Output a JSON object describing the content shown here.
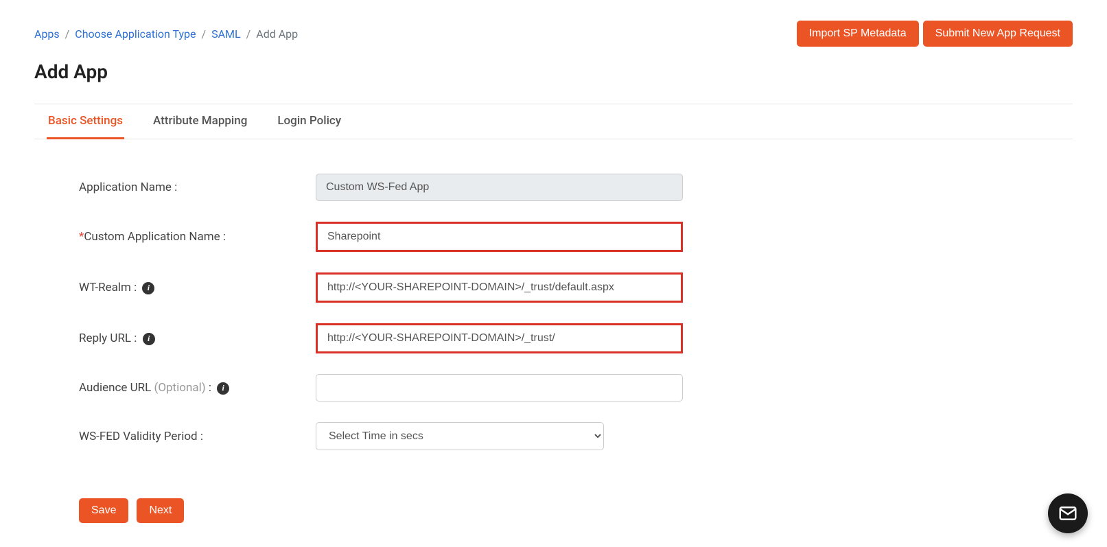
{
  "breadcrumb": {
    "apps": "Apps",
    "choose_type": "Choose Application Type",
    "saml": "SAML",
    "add_app": "Add App"
  },
  "topButtons": {
    "import": "Import SP Metadata",
    "submit": "Submit New App Request"
  },
  "pageTitle": "Add App",
  "tabs": {
    "basic": "Basic Settings",
    "attribute": "Attribute Mapping",
    "login": "Login Policy"
  },
  "form": {
    "appNameLabel": "Application Name :",
    "appNameValue": "Custom WS-Fed App",
    "customAppNameLabel": "Custom Application Name :",
    "customAppNameValue": "Sharepoint",
    "wtRealmLabel": "WT-Realm :",
    "wtRealmValue": "http://<YOUR-SHAREPOINT-DOMAIN>/_trust/default.aspx",
    "replyUrlLabel": "Reply URL :",
    "replyUrlValue": "http://<YOUR-SHAREPOINT-DOMAIN>/_trust/",
    "audienceUrlLabel": "Audience URL ",
    "audienceUrlOptional": "(Optional)",
    "audienceUrlSuffix": " :",
    "audienceUrlValue": "",
    "validityLabel": "WS-FED Validity Period :",
    "validityPlaceholder": "Select Time in secs"
  },
  "bottomButtons": {
    "save": "Save",
    "next": "Next"
  }
}
